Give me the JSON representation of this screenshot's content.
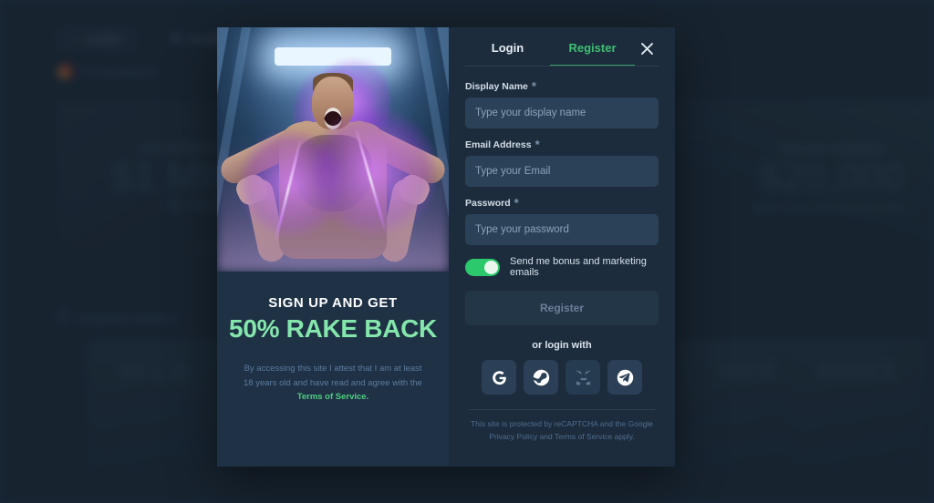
{
  "background": {
    "tabs": [
      {
        "label": "Lobby",
        "icon": "home-icon"
      },
      {
        "label": "Duelbits O",
        "icon": "trophy-icon"
      }
    ],
    "sections": [
      {
        "label": "Promotions",
        "icon": "gift-icon"
      },
      {
        "label": "Original Games",
        "icon": "dice-icon"
      }
    ],
    "banners": [
      {
        "small": "CELEBRATE CHRISTMAS",
        "big": "$1 MILLION",
        "sub": "IN REWARDS",
        "foot": ""
      },
      {
        "small": "RELAX GAMING",
        "big": "$20,000",
        "sub": "",
        "foot": "DEC 8-14 | TOP PRIZE $5,000 |"
      }
    ],
    "tiles": [
      {
        "label": "HI LO"
      },
      {
        "label": "DICE"
      },
      {
        "label": "MINES"
      }
    ]
  },
  "modal": {
    "promo": {
      "headline": "SIGN UP AND GET",
      "offer": "50% RAKE BACK",
      "disclaimer": "By accessing this site I attest that I am at least 18 years old and have read and agree with the ",
      "terms_link": "Terms of Service."
    },
    "tabs": [
      {
        "id": "login",
        "label": "Login",
        "active": false
      },
      {
        "id": "register",
        "label": "Register",
        "active": true
      }
    ],
    "close_icon": "close-icon",
    "fields": [
      {
        "label": "Display Name",
        "required_marker": "*",
        "placeholder": "Type your display name",
        "value": ""
      },
      {
        "label": "Email Address",
        "required_marker": "*",
        "placeholder": "Type your Email",
        "value": ""
      },
      {
        "label": "Password",
        "required_marker": "*",
        "placeholder": "Type your password",
        "value": ""
      }
    ],
    "marketing_toggle": {
      "label": "Send me bonus and marketing emails",
      "enabled": true,
      "on_color": "#2bc96b"
    },
    "submit_label": "Register",
    "or_login_with": "or login with",
    "social": [
      {
        "name": "google-icon",
        "glyph": "G",
        "muted": false
      },
      {
        "name": "steam-icon",
        "glyph": "",
        "muted": false
      },
      {
        "name": "metamask-icon",
        "glyph": "",
        "muted": true
      },
      {
        "name": "telegram-icon",
        "glyph": "",
        "muted": false
      }
    ],
    "recaptcha_notice": "This site is protected by reCAPTCHA and the Google Privacy Policy and Terms of Service apply."
  },
  "colors": {
    "accent_green": "#3fbf72",
    "offer_green": "#84e6ab",
    "toggle_green": "#2bc96b",
    "modal_form_bg": "#1c2c3d",
    "modal_promo_bg": "#1e3145",
    "input_bg": "#2a4157",
    "page_bg": "#243950"
  }
}
